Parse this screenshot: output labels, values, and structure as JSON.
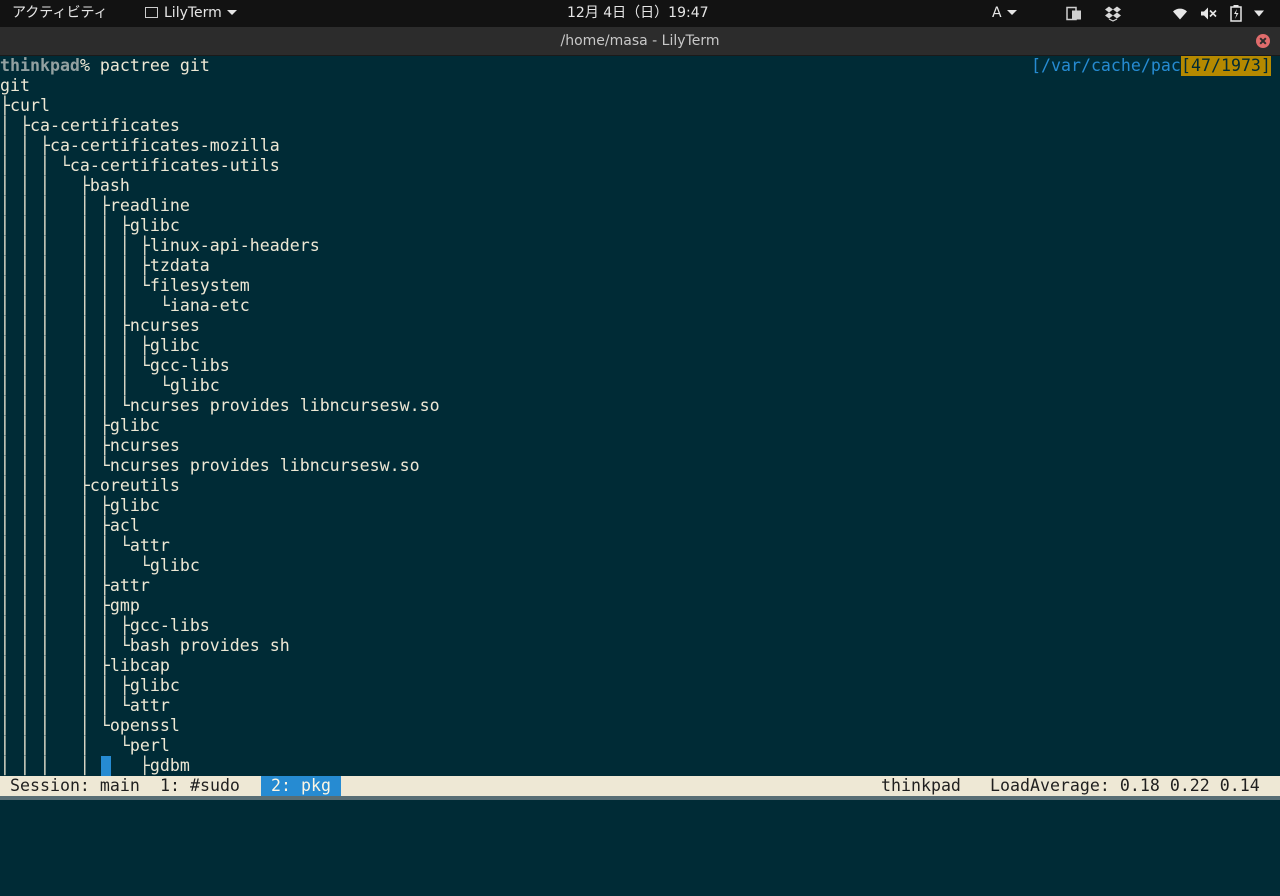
{
  "topbar": {
    "activities": "アクティビティ",
    "app_name": "LilyTerm",
    "clock": "12月 4日（日）19:47",
    "input_method": "A",
    "icons": [
      "clipboard-icon",
      "dropbox-icon",
      "wifi-icon",
      "volume-muted-icon",
      "battery-icon",
      "menu-arrow-icon"
    ]
  },
  "window": {
    "title": "/home/masa - LilyTerm"
  },
  "terminal": {
    "prompt_host": "thinkpad",
    "prompt_rest": "% pactree git",
    "right_prompt_path": "[/var/cache/pac",
    "right_prompt_count": "[47/1973]",
    "lines": [
      "git",
      "├curl",
      "│ ├ca-certificates",
      "│ │ ├ca-certificates-mozilla",
      "│ │ │ └ca-certificates-utils",
      "│ │ │   ├bash",
      "│ │ │   │ ├readline",
      "│ │ │   │ │ ├glibc",
      "│ │ │   │ │ │ ├linux-api-headers",
      "│ │ │   │ │ │ ├tzdata",
      "│ │ │   │ │ │ └filesystem",
      "│ │ │   │ │ │   └iana-etc",
      "│ │ │   │ │ ├ncurses",
      "│ │ │   │ │ │ ├glibc",
      "│ │ │   │ │ │ └gcc-libs",
      "│ │ │   │ │ │   └glibc",
      "│ │ │   │ │ └ncurses provides libncursesw.so",
      "│ │ │   │ ├glibc",
      "│ │ │   │ ├ncurses",
      "│ │ │   │ └ncurses provides libncursesw.so",
      "│ │ │   ├coreutils",
      "│ │ │   │ ├glibc",
      "│ │ │   │ ├acl",
      "│ │ │   │ │ └attr",
      "│ │ │   │ │   └glibc",
      "│ │ │   │ ├attr",
      "│ │ │   │ ├gmp",
      "│ │ │   │ │ ├gcc-libs",
      "│ │ │   │ │ └bash provides sh",
      "│ │ │   │ ├libcap",
      "│ │ │   │ │ ├glibc",
      "│ │ │   │ │ └attr",
      "│ │ │   │ └openssl",
      "│ │ │   │   └perl",
      "│ │ │   │     ├gdbm"
    ]
  },
  "statusbar": {
    "session": "Session: main",
    "window1": "1: #sudo",
    "window2": "2: pkg",
    "hostname": "thinkpad",
    "load": "LoadAverage: 0.18 0.22 0.14"
  }
}
